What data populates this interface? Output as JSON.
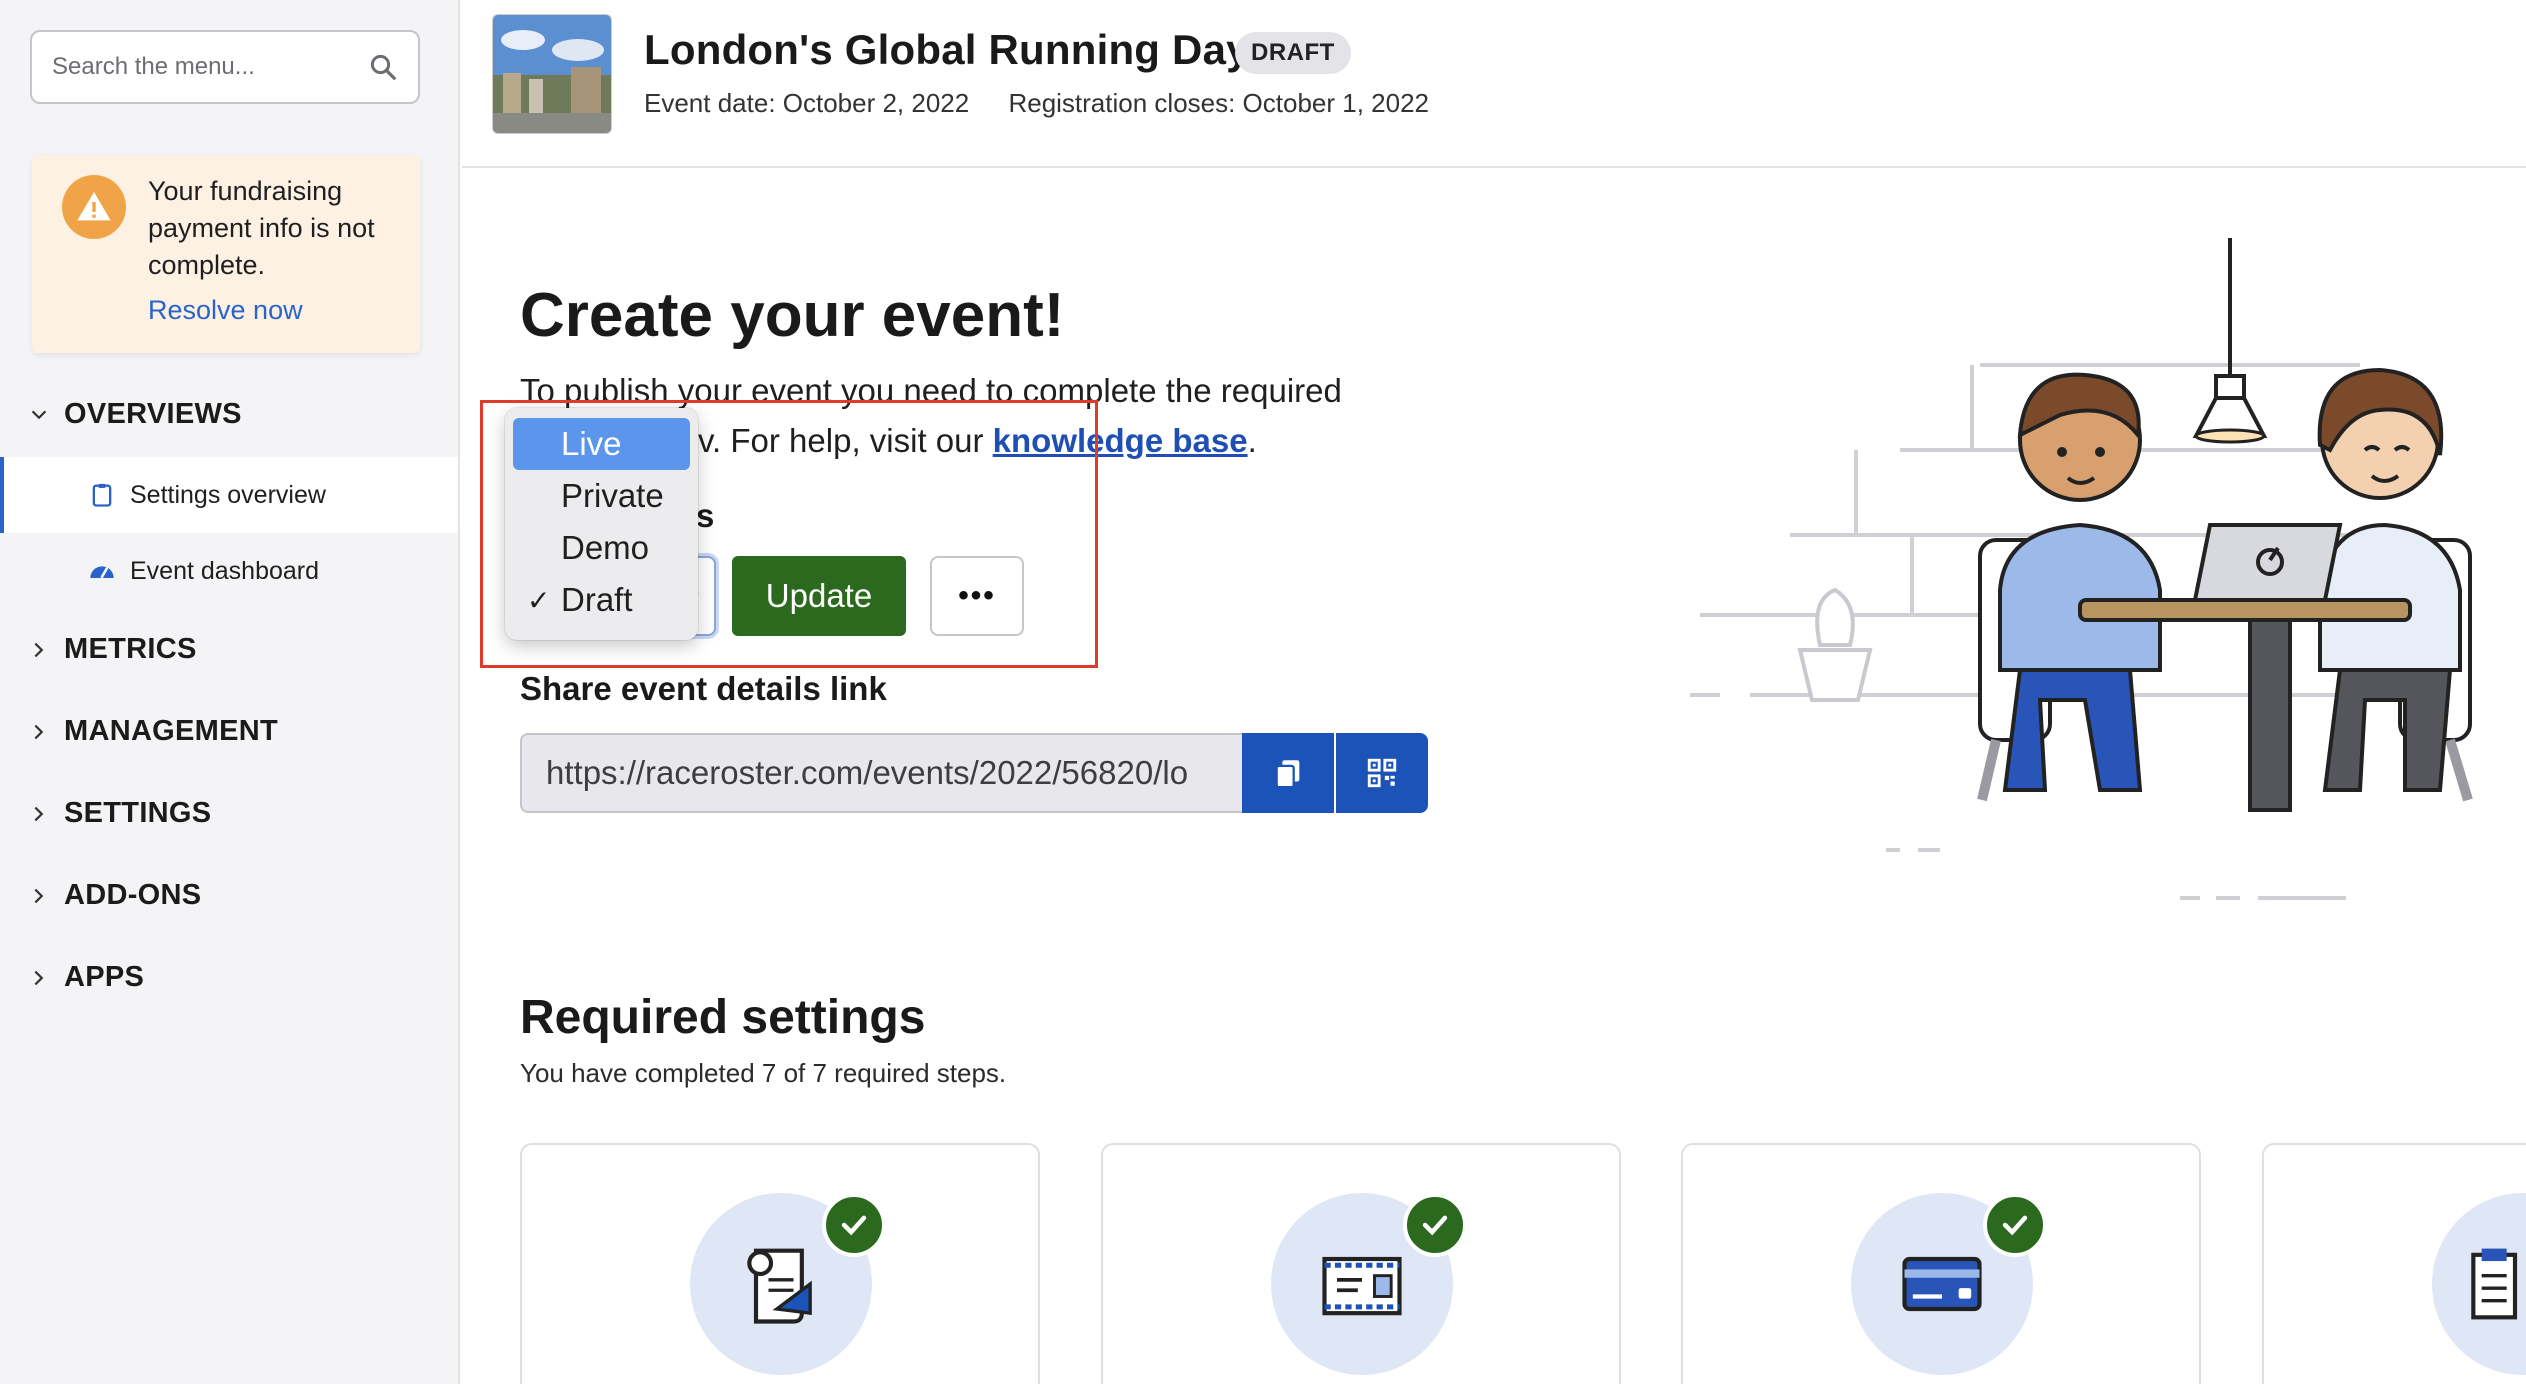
{
  "sidebar": {
    "search_placeholder": "Search the menu...",
    "alert": {
      "message": "Your fundraising payment info is not complete.",
      "link": "Resolve now"
    },
    "groups": {
      "overviews": "OVERVIEWS",
      "metrics": "METRICS",
      "management": "MANAGEMENT",
      "settings": "SETTINGS",
      "addons": "ADD-ONS",
      "apps": "APPS"
    },
    "items": {
      "settings_overview": "Settings overview",
      "event_dashboard": "Event dashboard"
    }
  },
  "header": {
    "title": "London's Global Running Day",
    "badge": "DRAFT",
    "event_date": "Event date: October 2, 2022",
    "registration_closes": "Registration closes: October 1, 2022"
  },
  "main": {
    "title": "Create your event!",
    "intro_line1": "To publish your event you need to complete the required",
    "intro_line2_visible": "v. For help, visit our ",
    "knowledge_link": "knowledge base",
    "intro_end": ".",
    "status_label_visible": "s",
    "status_options": [
      "Live",
      "Private",
      "Demo",
      "Draft"
    ],
    "status_hover": "Live",
    "status_selected": "Draft",
    "check_glyph": "✓",
    "update_label": "Update",
    "more_label": "•••",
    "share_label": "Share event details link",
    "share_url": "https://raceroster.com/events/2022/56820/lo"
  },
  "required": {
    "title": "Required settings",
    "subtitle": "You have completed 7 of 7 required steps."
  },
  "colors": {
    "accent_blue": "#1c53b8",
    "link_blue": "#2a63c9",
    "update_green": "#2b6a1e",
    "warning_orange": "#f0a447",
    "highlight_red": "#e03a2b"
  }
}
